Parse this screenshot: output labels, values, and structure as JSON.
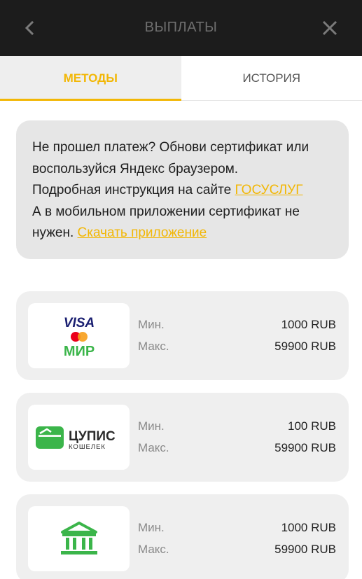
{
  "header": {
    "title": "ВЫПЛАТЫ",
    "back_icon": "chevron-left-icon",
    "close_icon": "close-icon"
  },
  "tabs": [
    {
      "label": "МЕТОДЫ",
      "active": true
    },
    {
      "label": "ИСТОРИЯ",
      "active": false
    }
  ],
  "notice": {
    "line1": "Не прошел платеж? Обнови сертификат или воспользуйся Яндекс браузером.",
    "line2_prefix": "Подробная инструкция на сайте ",
    "line2_link": "ГОСУСЛУГ",
    "line3_prefix": "А в мобильном приложении сертификат не нужен. ",
    "line3_link": "Скачать приложение"
  },
  "methods": [
    {
      "logo": "visa-mir-logo",
      "logo_texts": {
        "visa": "VISA",
        "mir": "МИР"
      },
      "min_label": "Мин.",
      "min_value": "1000 RUB",
      "max_label": "Макс.",
      "max_value": "59900 RUB"
    },
    {
      "logo": "cupis-wallet-logo",
      "logo_texts": {
        "name": "ЦУПИС",
        "sub": "КОШЕЛЕК"
      },
      "min_label": "Мин.",
      "min_value": "100 RUB",
      "max_label": "Макс.",
      "max_value": "59900 RUB"
    },
    {
      "logo": "bank-icon",
      "min_label": "Мин.",
      "min_value": "1000 RUB",
      "max_label": "Макс.",
      "max_value": "59900 RUB"
    }
  ],
  "colors": {
    "accent": "#f2b705",
    "header_bg": "#1c1c1c",
    "card_bg": "#efefef",
    "green": "#3bb54a",
    "visa_blue": "#1a1f71"
  }
}
